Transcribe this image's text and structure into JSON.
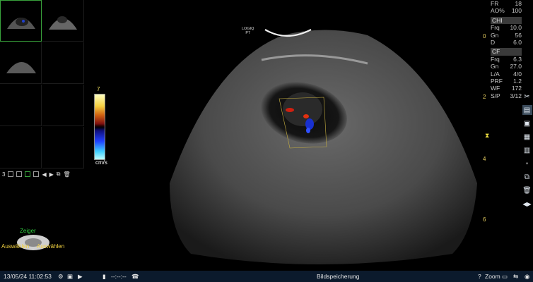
{
  "thumbnails": {
    "count_label": "3"
  },
  "colorbar": {
    "top_value": "7",
    "unit": "cm/s"
  },
  "logo": {
    "line1": "LOGIQ",
    "line2": "P7"
  },
  "params": {
    "top": [
      {
        "k": "FR",
        "v": "18"
      },
      {
        "k": "AO%",
        "v": "100"
      }
    ],
    "chi_header": "CHI",
    "chi": [
      {
        "k": "Frq",
        "v": "10.0"
      },
      {
        "k": "Gn",
        "v": "56"
      },
      {
        "k": "D",
        "v": "6.0"
      }
    ],
    "cf_header": "CF",
    "cf": [
      {
        "k": "Frq",
        "v": "6.3"
      },
      {
        "k": "Gn",
        "v": "27.0"
      },
      {
        "k": "L/A",
        "v": "4/0"
      },
      {
        "k": "PRF",
        "v": "1.2"
      },
      {
        "k": "WF",
        "v": "172"
      },
      {
        "k": "S/P",
        "v": "3/12"
      }
    ]
  },
  "ruler": {
    "labels": [
      "0",
      "2",
      "4",
      "6"
    ]
  },
  "trackball": {
    "top": "Zeiger",
    "left": "Auswählen",
    "right": "Auswählen"
  },
  "status": {
    "datetime": "13/05/24 11:02:53",
    "timer": "--:--:--",
    "center": "Bildspeicherung",
    "zoom": "Zoom"
  },
  "colors": {
    "accent_green": "#39a33c",
    "bottom_bar": "#0b1a2c",
    "label_yellow": "#f0d040"
  },
  "icons": [
    "tools-icon",
    "report-icon",
    "layout-1-icon",
    "layout-2-icon",
    "layout-3-icon",
    "lock-icon",
    "move-icon",
    "trash-icon",
    "arrow-left-icon",
    "arrow-right-icon"
  ]
}
